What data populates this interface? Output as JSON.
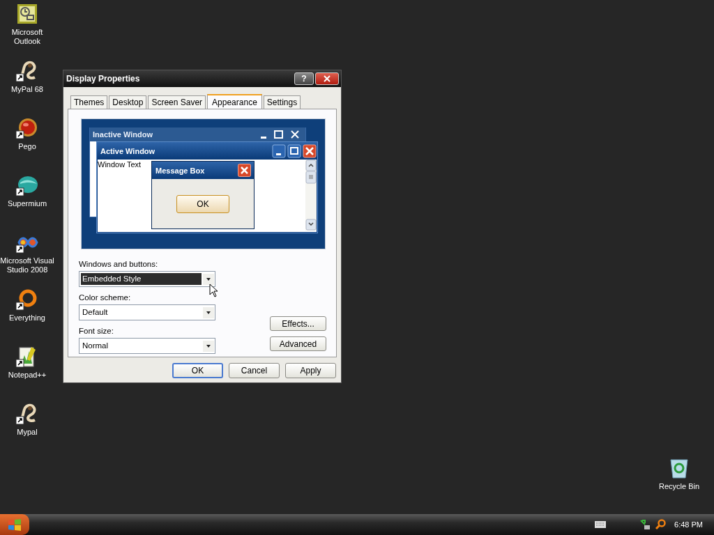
{
  "desktop_icons": [
    {
      "label": "Microsoft Outlook",
      "kind": "mail",
      "shortcut": false
    },
    {
      "label": "MyPal 68",
      "kind": "ferret",
      "shortcut": true
    },
    {
      "label": "Pego",
      "kind": "orb",
      "shortcut": true
    },
    {
      "label": "Supermium",
      "kind": "globe",
      "shortcut": true
    },
    {
      "label": "Microsoft Visual Studio 2008",
      "kind": "infinity",
      "shortcut": true
    },
    {
      "label": "Everything",
      "kind": "ring",
      "shortcut": true
    },
    {
      "label": "Notepad++",
      "kind": "notepad",
      "shortcut": true
    },
    {
      "label": "Mypal",
      "kind": "ferret",
      "shortcut": true
    }
  ],
  "recycle_bin": {
    "label": "Recycle Bin"
  },
  "dialog": {
    "title": "Display Properties",
    "help_button": "?",
    "tabs": [
      {
        "label": "Themes",
        "selected": false
      },
      {
        "label": "Desktop",
        "selected": false
      },
      {
        "label": "Screen Saver",
        "selected": false
      },
      {
        "label": "Appearance",
        "selected": true
      },
      {
        "label": "Settings",
        "selected": false
      }
    ],
    "preview": {
      "inactive_title": "Inactive Window",
      "active_title": "Active Window",
      "window_text": "Window Text",
      "message_box_title": "Message Box",
      "message_box_button": "OK"
    },
    "fields": [
      {
        "label": "Windows and buttons:",
        "value": "Embedded Style",
        "focused": true
      },
      {
        "label": "Color scheme:",
        "value": "Default",
        "focused": false
      },
      {
        "label": "Font size:",
        "value": "Normal",
        "focused": false
      }
    ],
    "side_buttons": [
      "Effects...",
      "Advanced"
    ],
    "buttons": [
      {
        "label": "OK",
        "default": true
      },
      {
        "label": "Cancel",
        "default": false
      },
      {
        "label": "Apply",
        "default": false
      }
    ]
  },
  "taskbar": {
    "clock": "6:48 PM"
  }
}
